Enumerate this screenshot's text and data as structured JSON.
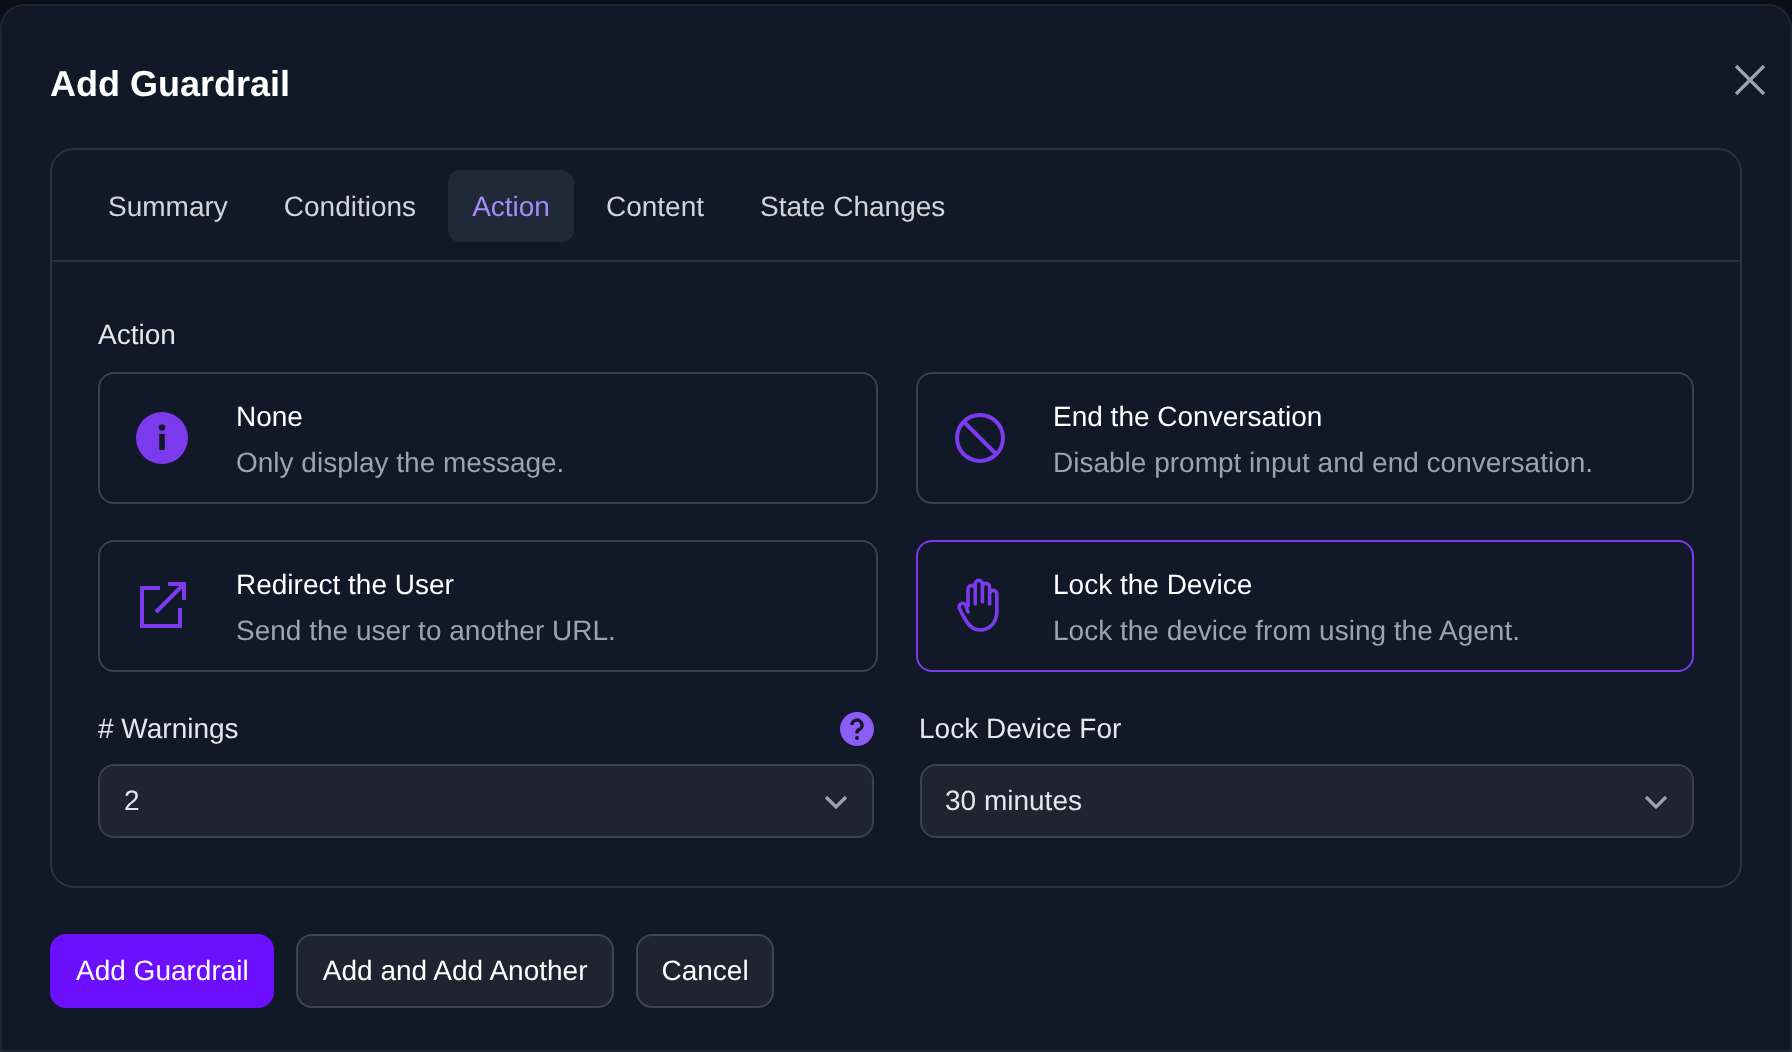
{
  "dialog": {
    "title": "Add Guardrail"
  },
  "tabs": [
    {
      "label": "Summary",
      "selected": false
    },
    {
      "label": "Conditions",
      "selected": false
    },
    {
      "label": "Action",
      "selected": true
    },
    {
      "label": "Content",
      "selected": false
    },
    {
      "label": "State Changes",
      "selected": false
    }
  ],
  "action": {
    "label": "Action",
    "options": [
      {
        "kind": "info",
        "title": "None",
        "description": "Only display the message.",
        "selected": false
      },
      {
        "kind": "ban",
        "title": "End the Conversation",
        "description": "Disable prompt input and end conversation.",
        "selected": false
      },
      {
        "kind": "redirect",
        "title": "Redirect the User",
        "description": "Send the user to another URL.",
        "selected": false
      },
      {
        "kind": "hand",
        "title": "Lock the Device",
        "description": "Lock the device from using the Agent.",
        "selected": true
      }
    ]
  },
  "fields": [
    {
      "label": "# Warnings",
      "value": "2",
      "help": true
    },
    {
      "label": "Lock Device For",
      "value": "30 minutes",
      "help": false
    }
  ],
  "buttons": [
    {
      "label": "Add Guardrail",
      "kind": "primary"
    },
    {
      "label": "Add and Add Another",
      "kind": "secondary"
    },
    {
      "label": "Cancel",
      "kind": "secondary"
    }
  ]
}
